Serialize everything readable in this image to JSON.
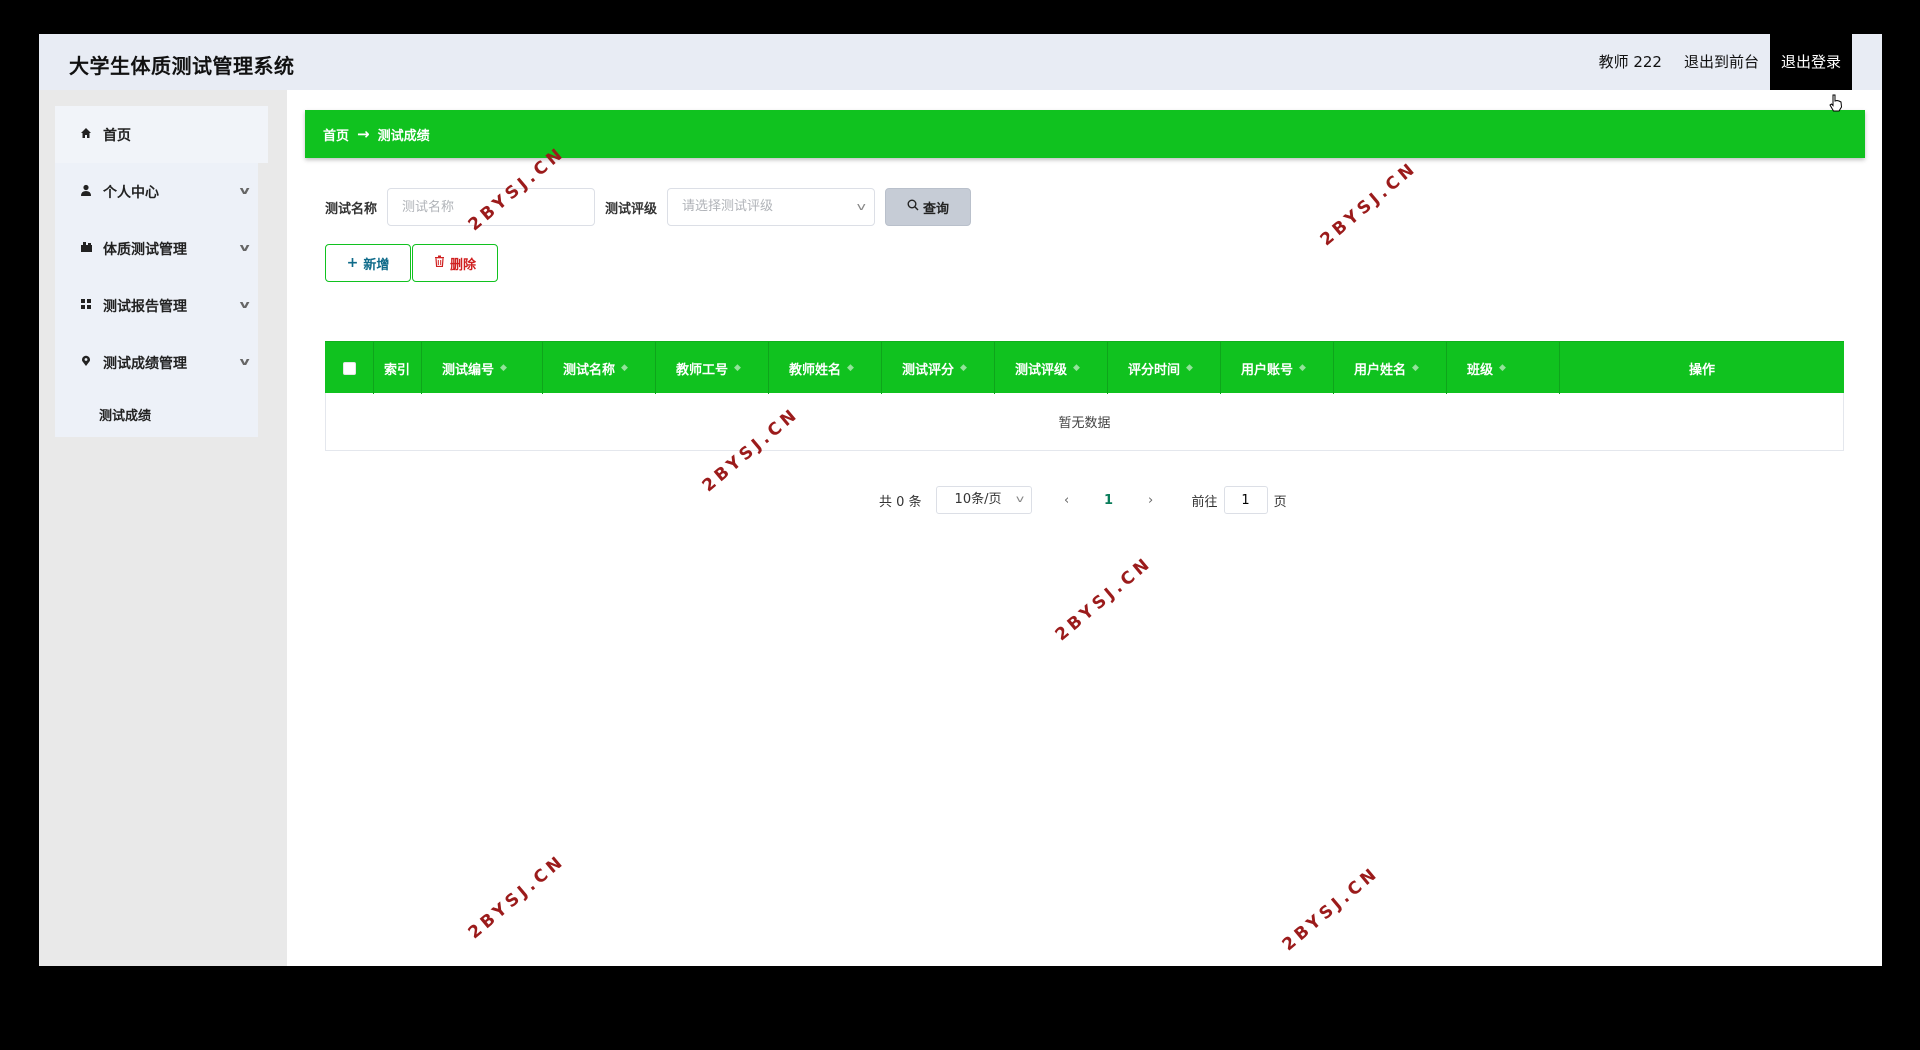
{
  "header": {
    "title": "大学生体质测试管理系统",
    "user_label": "教师 222",
    "front_label": "退出到前台",
    "logout_label": "退出登录"
  },
  "sidebar": {
    "items": [
      {
        "label": "首页",
        "icon": "home-icon"
      },
      {
        "label": "个人中心",
        "icon": "user-icon"
      },
      {
        "label": "体质测试管理",
        "icon": "dumbbell-icon"
      },
      {
        "label": "测试报告管理",
        "icon": "grid-icon"
      },
      {
        "label": "测试成绩管理",
        "icon": "location-icon"
      }
    ],
    "subitem": "测试成绩"
  },
  "breadcrumb": {
    "home": "首页",
    "arrow": "→",
    "current": "测试成绩"
  },
  "search": {
    "name_label": "测试名称",
    "name_placeholder": "测试名称",
    "grade_label": "测试评级",
    "grade_placeholder": "请选择测试评级",
    "query_label": "查询"
  },
  "actions": {
    "add_label": "新增",
    "delete_label": "删除"
  },
  "table": {
    "index_header": "索引",
    "columns": [
      "测试编号",
      "测试名称",
      "教师工号",
      "教师姓名",
      "测试评分",
      "测试评级",
      "评分时间",
      "用户账号",
      "用户姓名",
      "班级"
    ],
    "op_header": "操作",
    "empty_text": "暂无数据"
  },
  "pagination": {
    "total": "共 0 条",
    "page_size": "10条/页",
    "current_page": "1",
    "goto_prefix": "前往",
    "goto_value": "1",
    "goto_suffix": "页"
  },
  "watermark": "2BYSJ.CN",
  "colors": {
    "primary_green": "#10c21f",
    "header_bg": "#e8ecf4",
    "sidebar_bg": "#e9e9e9",
    "watermark": "#9b1b1b"
  }
}
